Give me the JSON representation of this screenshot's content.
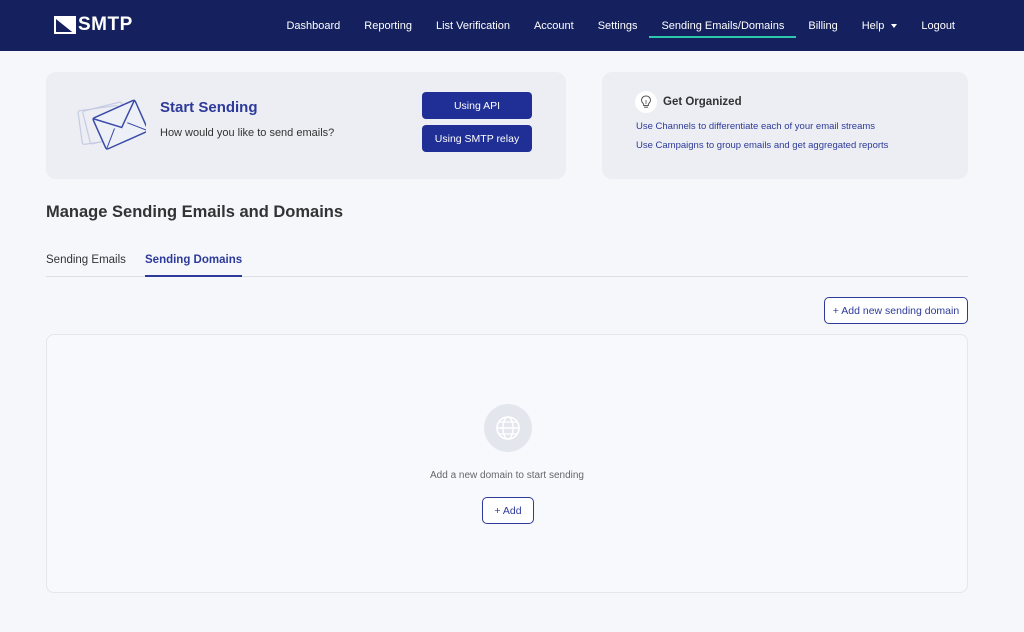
{
  "nav": {
    "logo": "SMTP",
    "items": [
      {
        "label": "Dashboard"
      },
      {
        "label": "Reporting"
      },
      {
        "label": "List Verification"
      },
      {
        "label": "Account"
      },
      {
        "label": "Settings"
      },
      {
        "label": "Sending Emails/Domains",
        "active": true
      },
      {
        "label": "Billing"
      },
      {
        "label": "Help",
        "dropdown": true
      },
      {
        "label": "Logout"
      }
    ]
  },
  "start_card": {
    "title": "Start Sending",
    "subtitle": "How would you like to send emails?",
    "btn_api": "Using API",
    "btn_smtp": "Using SMTP relay"
  },
  "org_card": {
    "title": "Get Organized",
    "link1": "Use Channels to differentiate each of your email streams",
    "link2": "Use Campaigns to group emails and get aggregated reports"
  },
  "page": {
    "title": "Manage Sending Emails and Domains"
  },
  "tabs": {
    "emails": "Sending Emails",
    "domains": "Sending Domains"
  },
  "actions": {
    "add_new": "+ Add new sending domain"
  },
  "empty": {
    "text": "Add a new domain to start sending",
    "add": "+ Add"
  },
  "colors": {
    "nav_bg": "#14215e",
    "accent": "#2d3a9a",
    "active_underline": "#2fc6ae",
    "button_primary": "#1f2f95"
  }
}
